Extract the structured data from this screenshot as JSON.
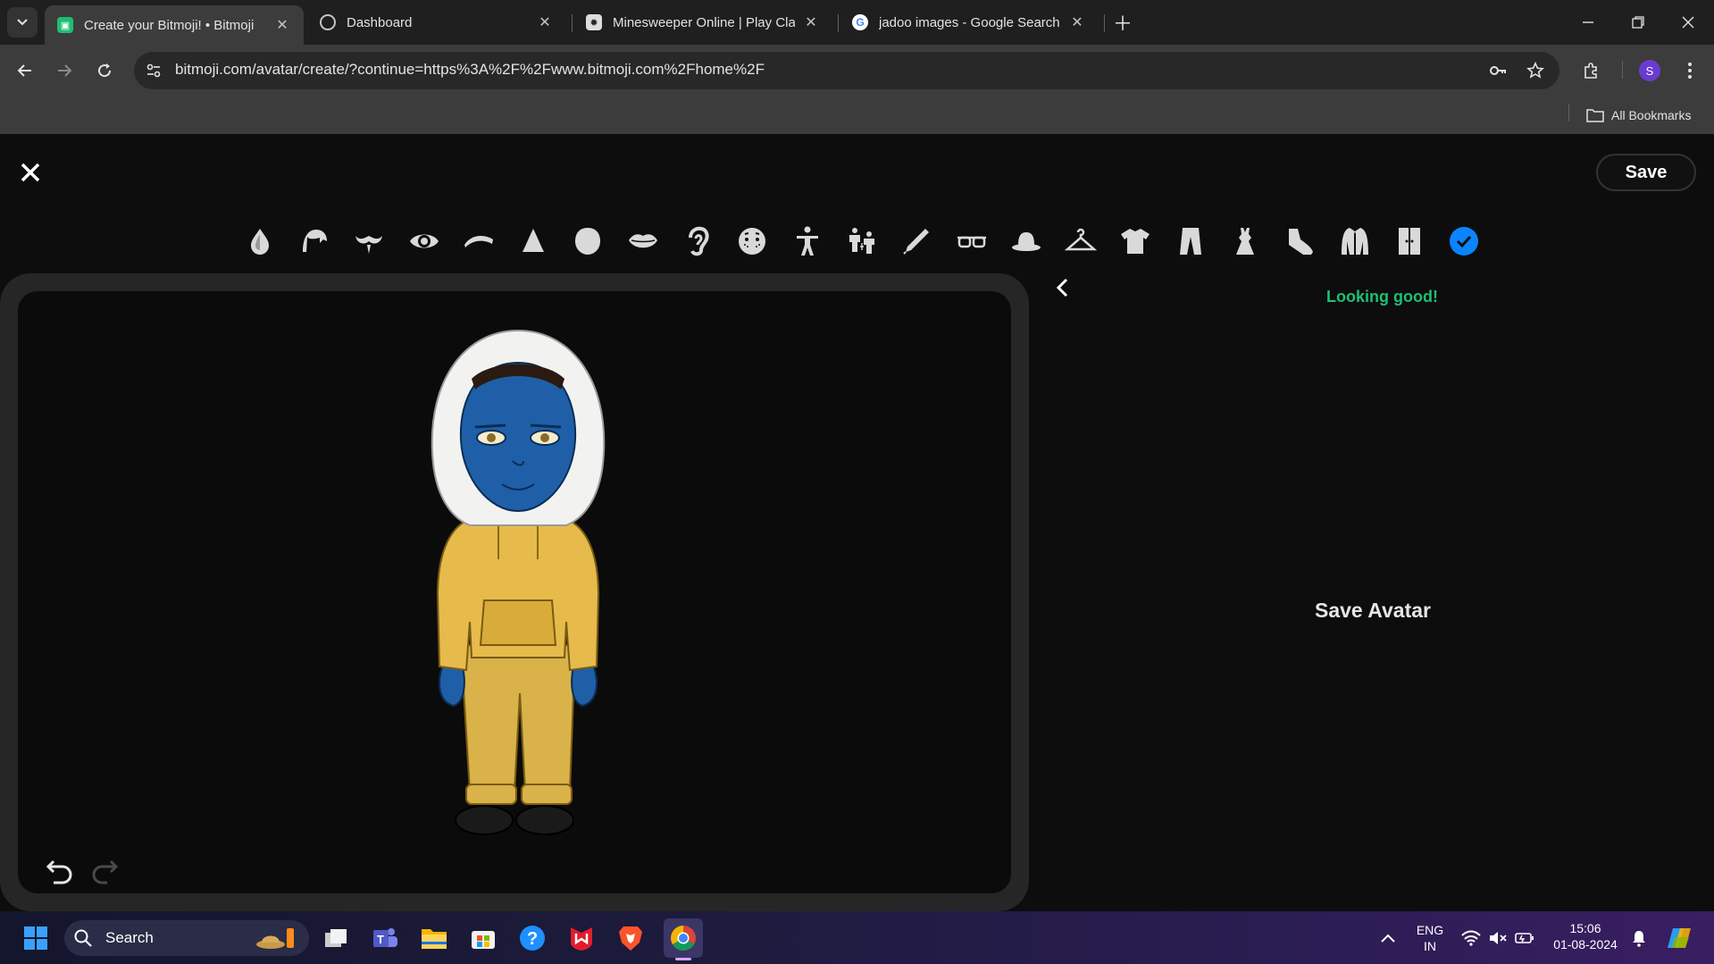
{
  "browser": {
    "tabs": [
      {
        "title": "Create your Bitmoji! • Bitmoji",
        "active": true
      },
      {
        "title": "Dashboard",
        "active": false
      },
      {
        "title": "Minesweeper Online | Play Clas",
        "active": false
      },
      {
        "title": "jadoo images - Google Search",
        "active": false
      }
    ],
    "url": "bitmoji.com/avatar/create/?continue=https%3A%2F%2Fwww.bitmoji.com%2Fhome%2F",
    "bookmarks_label": "All Bookmarks",
    "profile_initial": "S"
  },
  "app": {
    "save_label": "Save",
    "status_message": "Looking good!",
    "save_avatar_label": "Save Avatar",
    "categories": [
      "skin-tone",
      "hair",
      "facial-hair",
      "eyes",
      "eyebrows",
      "nose",
      "face-shape",
      "mouth",
      "ears",
      "face-details",
      "body",
      "body-proportions",
      "makeup",
      "glasses",
      "hat",
      "outfit",
      "top",
      "bottom",
      "dress",
      "shoes",
      "outerwear",
      "wardrobe",
      "done"
    ],
    "accent_color": "#1fbf72",
    "done_color": "#0a84ff"
  },
  "taskbar": {
    "search_label": "Search",
    "lang_line1": "ENG",
    "lang_line2": "IN",
    "time": "15:06",
    "date": "01-08-2024"
  }
}
